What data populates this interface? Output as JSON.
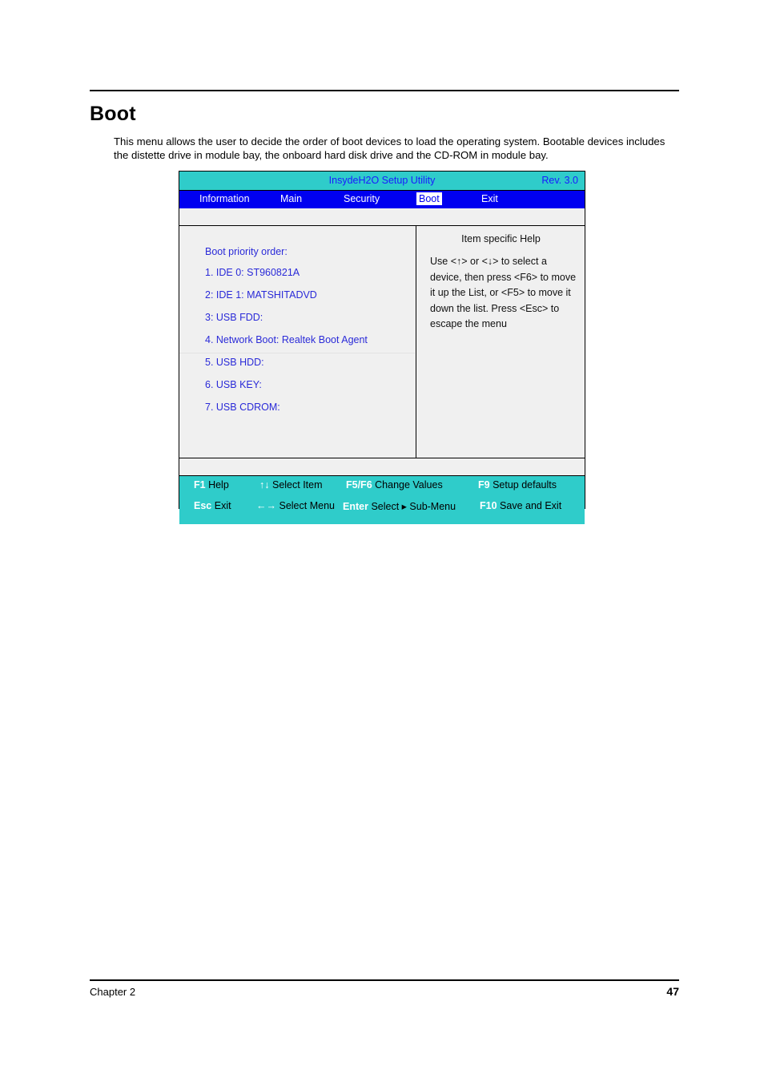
{
  "document": {
    "heading": "Boot",
    "intro": "This menu allows the user to decide the order of boot devices to load the operating system. Bootable devices includes the distette drive in module bay, the onboard hard disk drive and the CD-ROM in module bay.",
    "footer_left": "Chapter 2",
    "footer_page": "47"
  },
  "bios": {
    "title": "InsydeH2O Setup Utility",
    "revision": "Rev. 3.0",
    "menu": [
      {
        "label": "Information",
        "selected": false
      },
      {
        "label": "Main",
        "selected": false
      },
      {
        "label": "Security",
        "selected": false
      },
      {
        "label": "Boot",
        "selected": true
      },
      {
        "label": "Exit",
        "selected": false
      }
    ],
    "boot": {
      "heading": "Boot priority order:",
      "items": [
        "1. IDE 0: ST960821A",
        "2: IDE 1: MATSHITADVD",
        "3: USB FDD:",
        "4. Network Boot: Realtek Boot Agent",
        "5. USB HDD:",
        "6. USB KEY:",
        "7. USB CDROM:"
      ]
    },
    "help": {
      "title": "Item specific Help",
      "text": "Use <↑> or <↓> to select a device, then press <F6> to move it up the List, or <F5> to move it down the list. Press <Esc> to escape the menu"
    },
    "keybar": {
      "row1": [
        {
          "key": "F1",
          "action": "Help"
        },
        {
          "key": "↑↓",
          "action": "Select Item"
        },
        {
          "key": "F5/F6",
          "action": "Change Values"
        },
        {
          "key": "F9",
          "action": "Setup defaults"
        }
      ],
      "row2": [
        {
          "key": "Esc",
          "action": "Exit"
        },
        {
          "key": "←→",
          "action": "Select Menu"
        },
        {
          "key": "Enter",
          "action": "Select ▸ Sub-Menu"
        },
        {
          "key": "F10",
          "action": "Save and Exit"
        }
      ]
    },
    "colors": {
      "titlebar": "#2fccca",
      "menubar": "#0000f0",
      "menu_text": "#ffffff",
      "title_text": "#1a1aff",
      "list_text": "#2a2ad8",
      "panel_bg": "#f0f0f0",
      "keybar": "#2fccca"
    }
  }
}
